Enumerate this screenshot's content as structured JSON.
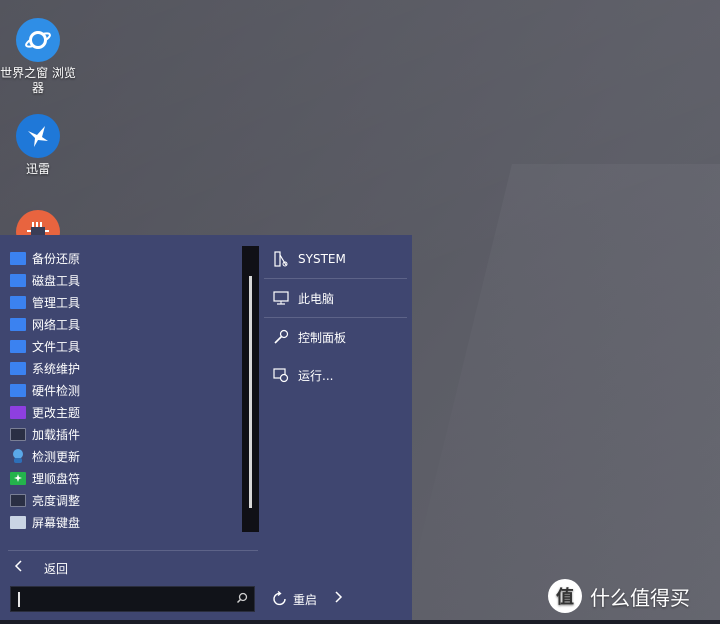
{
  "desktop": {
    "icons": [
      {
        "label": "世界之窗 浏览器"
      },
      {
        "label": "迅雷"
      },
      {
        "label": ""
      }
    ]
  },
  "start_menu": {
    "programs": [
      {
        "label": "备份还原",
        "icon": "folder-icon"
      },
      {
        "label": "磁盘工具",
        "icon": "folder-icon"
      },
      {
        "label": "管理工具",
        "icon": "folder-icon"
      },
      {
        "label": "网络工具",
        "icon": "folder-icon"
      },
      {
        "label": "文件工具",
        "icon": "folder-icon"
      },
      {
        "label": "系统维护",
        "icon": "folder-icon"
      },
      {
        "label": "硬件检测",
        "icon": "folder-icon"
      },
      {
        "label": "更改主题",
        "icon": "theme-icon"
      },
      {
        "label": "加载插件",
        "icon": "console-icon"
      },
      {
        "label": "检测更新",
        "icon": "update-icon"
      },
      {
        "label": "理顺盘符",
        "icon": "disk-order-icon"
      },
      {
        "label": "亮度调整",
        "icon": "console-icon"
      },
      {
        "label": "屏幕键盘",
        "icon": "keyboard-icon"
      }
    ],
    "back_label": "返回",
    "search": {
      "value": "",
      "placeholder": ""
    },
    "right": {
      "system": "SYSTEM",
      "this_pc": "此电脑",
      "control_panel": "控制面板",
      "run": "运行..."
    },
    "restart_label": "重启"
  },
  "watermark": {
    "text": "什么值得买",
    "badge": "值"
  },
  "colors": {
    "menu_bg": "#3f4670",
    "folder": "#3b82f0",
    "theme": "#8e3fe0"
  }
}
